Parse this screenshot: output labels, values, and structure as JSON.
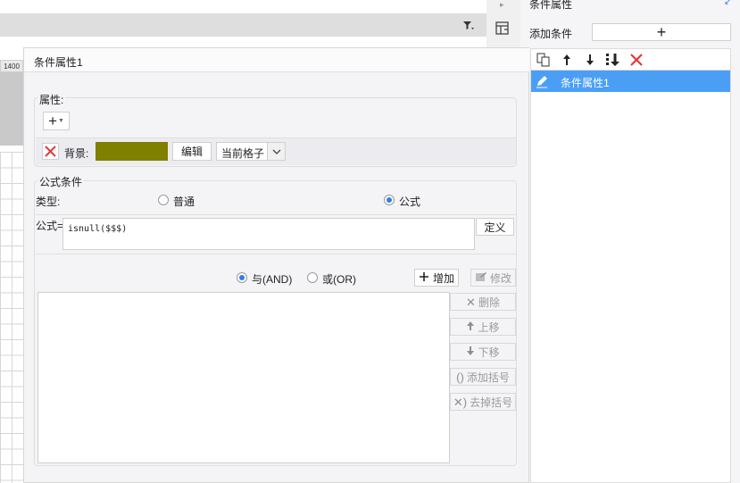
{
  "sheet": {
    "ruler_label": "1400"
  },
  "right_panel": {
    "title": "条件属性",
    "add_condition_label": "添加条件",
    "add_button_glyph": "+",
    "toolbar_icons": [
      "copy-icon",
      "arrow-up-icon",
      "arrow-down-icon",
      "sort-icon",
      "delete-icon"
    ],
    "items": [
      {
        "label": "条件属性1",
        "selected": true,
        "icon": "pencil-icon"
      }
    ]
  },
  "dialog": {
    "title": "条件属性1",
    "properties": {
      "group_label": "属性:",
      "add_button_glyph": "+",
      "background_label": "背景:",
      "background_color": "#808000",
      "edit_button": "编辑",
      "scope_selected": "当前格子"
    },
    "formula": {
      "group_label": "公式条件",
      "type_label": "类型:",
      "type_options": [
        {
          "label": "普通",
          "selected": false
        },
        {
          "label": "公式",
          "selected": true
        }
      ],
      "formula_label": "公式=",
      "formula_value": "isnull($$$)",
      "define_button": "定义",
      "logic_options": [
        {
          "label": "与(AND)",
          "selected": true
        },
        {
          "label": "或(OR)",
          "selected": false
        }
      ],
      "add_button": "增加",
      "modify_button": "修改",
      "side_buttons": {
        "delete": "删除",
        "up": "上移",
        "down": "下移",
        "add_paren": "添加括号",
        "remove_paren": "去掉括号"
      }
    }
  },
  "colors": {
    "accent": "#4a9ff5",
    "danger": "#e03a3a",
    "radio_on": "#2f7fe8"
  }
}
